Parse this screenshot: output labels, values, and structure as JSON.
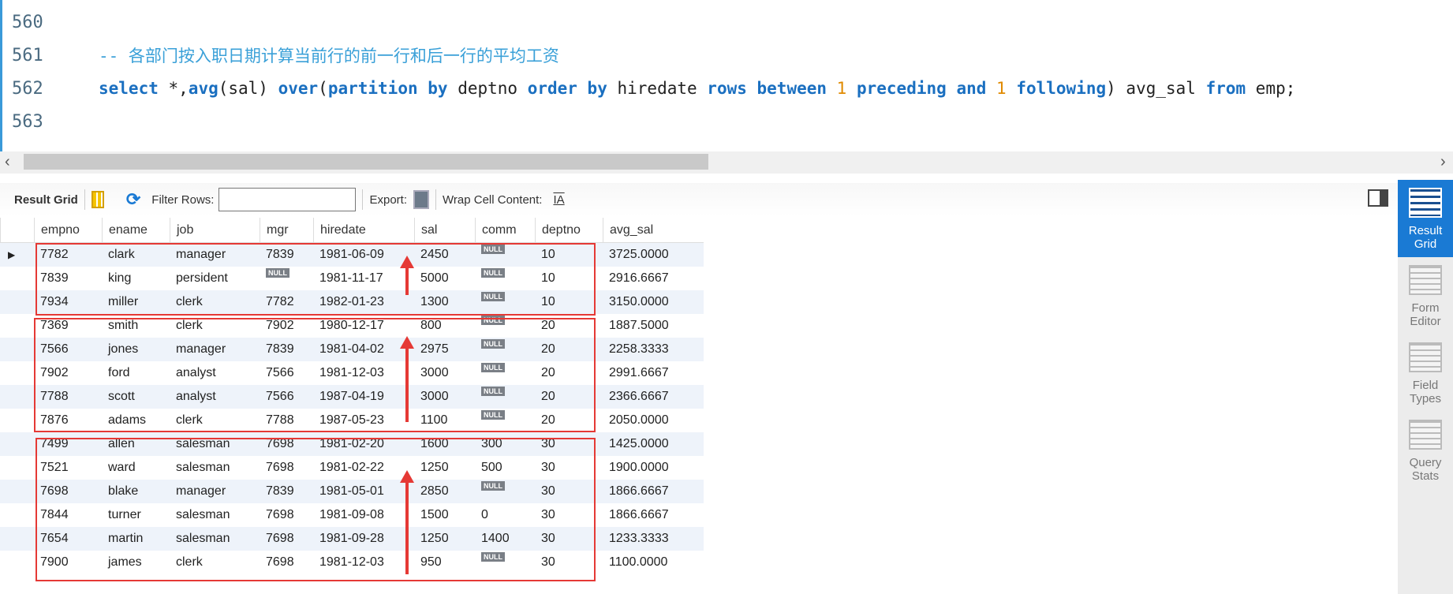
{
  "editor": {
    "lines": [
      {
        "num": "560",
        "text": ""
      },
      {
        "num": "561",
        "text": "-- 各部门按入职日期计算当前行的前一行和后一行的平均工资"
      },
      {
        "num": "562",
        "tokens": [
          {
            "t": "select",
            "c": "kw"
          },
          {
            "t": " *,",
            "c": "plain"
          },
          {
            "t": "avg",
            "c": "kw"
          },
          {
            "t": "(sal) ",
            "c": "plain"
          },
          {
            "t": "over",
            "c": "kw"
          },
          {
            "t": "(",
            "c": "plain"
          },
          {
            "t": "partition by",
            "c": "kw"
          },
          {
            "t": " deptno ",
            "c": "plain"
          },
          {
            "t": "order by",
            "c": "kw"
          },
          {
            "t": " hiredate ",
            "c": "plain"
          },
          {
            "t": "rows between",
            "c": "kw"
          },
          {
            "t": " ",
            "c": "plain"
          },
          {
            "t": "1",
            "c": "num"
          },
          {
            "t": " ",
            "c": "plain"
          },
          {
            "t": "preceding",
            "c": "kw"
          },
          {
            "t": " ",
            "c": "plain"
          },
          {
            "t": "and",
            "c": "kw"
          },
          {
            "t": " ",
            "c": "plain"
          },
          {
            "t": "1",
            "c": "num"
          },
          {
            "t": " ",
            "c": "plain"
          },
          {
            "t": "following",
            "c": "kw"
          },
          {
            "t": ") avg_sal ",
            "c": "plain"
          },
          {
            "t": "from",
            "c": "kw"
          },
          {
            "t": " emp;",
            "c": "plain"
          }
        ]
      },
      {
        "num": "563",
        "text": ""
      }
    ]
  },
  "toolbar": {
    "result_grid": "Result Grid",
    "filter_rows": "Filter Rows:",
    "filter_value": "",
    "export": "Export:",
    "wrap": "Wrap Cell Content:"
  },
  "grid": {
    "columns": [
      "empno",
      "ename",
      "job",
      "mgr",
      "hiredate",
      "sal",
      "comm",
      "deptno",
      "avg_sal"
    ],
    "rows": [
      [
        "7782",
        "clark",
        "manager",
        "7839",
        "1981-06-09",
        "2450",
        null,
        "10",
        "3725.0000"
      ],
      [
        "7839",
        "king",
        "persident",
        null,
        "1981-11-17",
        "5000",
        null,
        "10",
        "2916.6667"
      ],
      [
        "7934",
        "miller",
        "clerk",
        "7782",
        "1982-01-23",
        "1300",
        null,
        "10",
        "3150.0000"
      ],
      [
        "7369",
        "smith",
        "clerk",
        "7902",
        "1980-12-17",
        "800",
        null,
        "20",
        "1887.5000"
      ],
      [
        "7566",
        "jones",
        "manager",
        "7839",
        "1981-04-02",
        "2975",
        null,
        "20",
        "2258.3333"
      ],
      [
        "7902",
        "ford",
        "analyst",
        "7566",
        "1981-12-03",
        "3000",
        null,
        "20",
        "2991.6667"
      ],
      [
        "7788",
        "scott",
        "analyst",
        "7566",
        "1987-04-19",
        "3000",
        null,
        "20",
        "2366.6667"
      ],
      [
        "7876",
        "adams",
        "clerk",
        "7788",
        "1987-05-23",
        "1100",
        null,
        "20",
        "2050.0000"
      ],
      [
        "7499",
        "allen",
        "salesman",
        "7698",
        "1981-02-20",
        "1600",
        "300",
        "30",
        "1425.0000"
      ],
      [
        "7521",
        "ward",
        "salesman",
        "7698",
        "1981-02-22",
        "1250",
        "500",
        "30",
        "1900.0000"
      ],
      [
        "7698",
        "blake",
        "manager",
        "7839",
        "1981-05-01",
        "2850",
        null,
        "30",
        "1866.6667"
      ],
      [
        "7844",
        "turner",
        "salesman",
        "7698",
        "1981-09-08",
        "1500",
        "0",
        "30",
        "1866.6667"
      ],
      [
        "7654",
        "martin",
        "salesman",
        "7698",
        "1981-09-28",
        "1250",
        "1400",
        "30",
        "1233.3333"
      ],
      [
        "7900",
        "james",
        "clerk",
        "7698",
        "1981-12-03",
        "950",
        null,
        "30",
        "1100.0000"
      ]
    ],
    "null_label": "NULL"
  },
  "side_panel": [
    {
      "label": "Result Grid",
      "active": true
    },
    {
      "label": "Form Editor",
      "active": false
    },
    {
      "label": "Field Types",
      "active": false
    },
    {
      "label": "Query Stats",
      "active": false
    }
  ],
  "annotation_color": "#e53935",
  "accent": "#1a7ad4"
}
